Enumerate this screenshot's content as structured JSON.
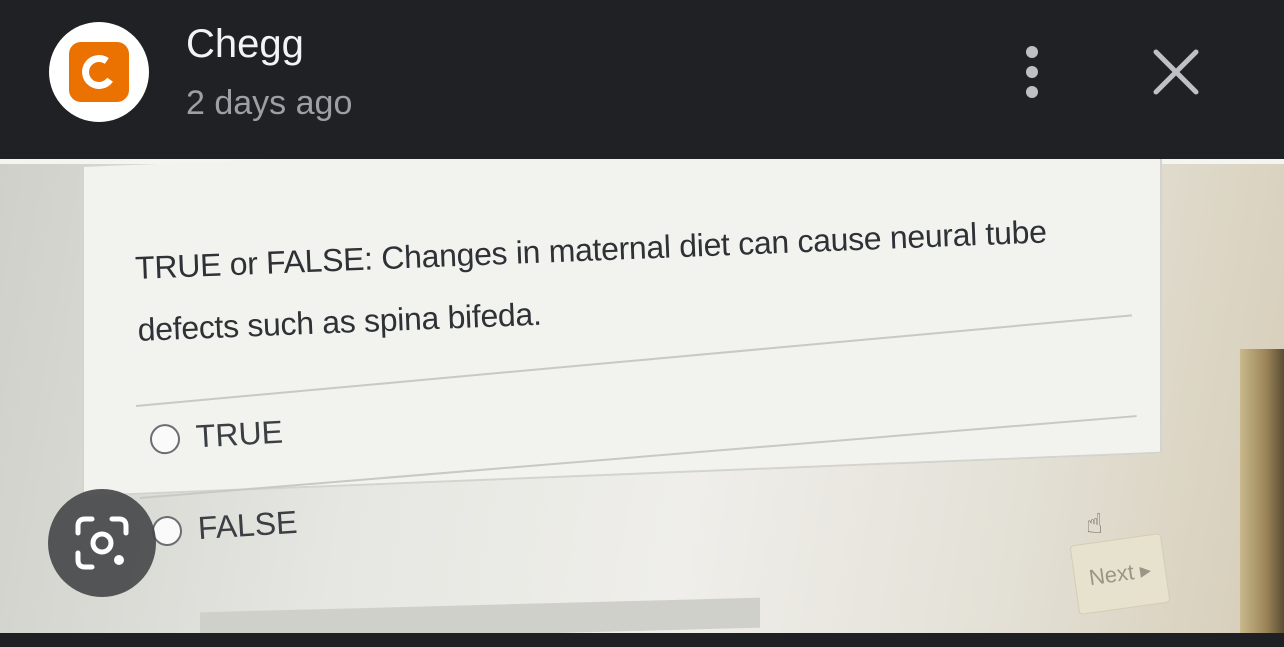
{
  "header": {
    "source_name": "Chegg",
    "timestamp": "2 days ago",
    "logo_icon": "chegg-logo-icon",
    "more_icon": "more-vert-icon",
    "close_icon": "close-icon"
  },
  "photo": {
    "question_text": "TRUE or FALSE: Changes in maternal diet can cause neural tube defects such as spina bifeda.",
    "options": [
      {
        "label": "TRUE"
      },
      {
        "label": "FALSE"
      }
    ],
    "next_label": "Next ▸"
  },
  "lens_button": {
    "icon": "google-lens-icon"
  },
  "colors": {
    "background": "#202124",
    "chegg_orange": "#eb7100",
    "title_text": "#f1f3f4",
    "secondary_text": "#9aa0a6"
  }
}
